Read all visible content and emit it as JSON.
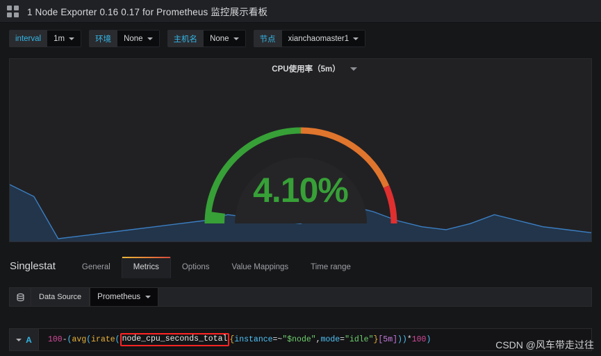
{
  "topbar": {
    "icon": "grid-icon",
    "title": "1 Node Exporter 0.16 0.17 for Prometheus 监控展示看板"
  },
  "variables": [
    {
      "label": "interval",
      "value": "1m"
    },
    {
      "label": "环境",
      "value": "None"
    },
    {
      "label": "主机名",
      "value": "None"
    },
    {
      "label": "节点",
      "value": "xianchaomaster1"
    }
  ],
  "panel": {
    "title": "CPU使用率（5m）",
    "menu_icon": "chevron-down-icon",
    "value_text": "4.10%"
  },
  "chart_data": {
    "type": "gauge",
    "title": "CPU使用率（5m）",
    "value": 4.1,
    "unit": "%",
    "min": 0,
    "max": 100,
    "value_color": "#37a037",
    "thresholds": [
      {
        "from": 0,
        "to": 50,
        "color": "#37a037"
      },
      {
        "from": 50,
        "to": 87,
        "color": "#e0752d"
      },
      {
        "from": 87,
        "to": 100,
        "color": "#e02f2f"
      }
    ],
    "sparkline": {
      "line_color": "#3b7fc4",
      "fill_color": "#23354a",
      "points": [
        62,
        58,
        44,
        45,
        46,
        47,
        48,
        49,
        50,
        52,
        51,
        50,
        49,
        52,
        55,
        53,
        50,
        48,
        47,
        49,
        52,
        50,
        48,
        47,
        46
      ]
    }
  },
  "editor": {
    "title": "Singlestat",
    "tabs": [
      {
        "label": "General",
        "active": false
      },
      {
        "label": "Metrics",
        "active": true
      },
      {
        "label": "Options",
        "active": false
      },
      {
        "label": "Value Mappings",
        "active": false
      },
      {
        "label": "Time range",
        "active": false
      }
    ]
  },
  "datasource": {
    "icon": "database-icon",
    "label": "Data Source",
    "value": "Prometheus"
  },
  "query": {
    "ref_id": "A",
    "collapse_icon": "chevron-down-icon",
    "expression": "100 - (avg(irate(node_cpu_seconds_total{instance=~\"$node\",mode=\"idle\"}[5m])) * 100)",
    "tokens": {
      "t1": "100",
      "t2": " - ",
      "t3": "(",
      "t4": "avg",
      "t5": "(",
      "t6": "irate",
      "t7": "(",
      "t8": "node_cpu_seconds_total",
      "t9": "{",
      "t10": "instance",
      "t11": "=~",
      "t12": "\"$node\"",
      "t13": ",",
      "t14": "mode",
      "t15": "=",
      "t16": "\"idle\"",
      "t17": "}",
      "t18": "[5m]",
      "t19": "))",
      "t20": " * ",
      "t21": "100",
      "t22": ")"
    },
    "highlight": "node_cpu_seconds_total"
  },
  "watermark": {
    "text": "CSDN @风车带走过往"
  }
}
